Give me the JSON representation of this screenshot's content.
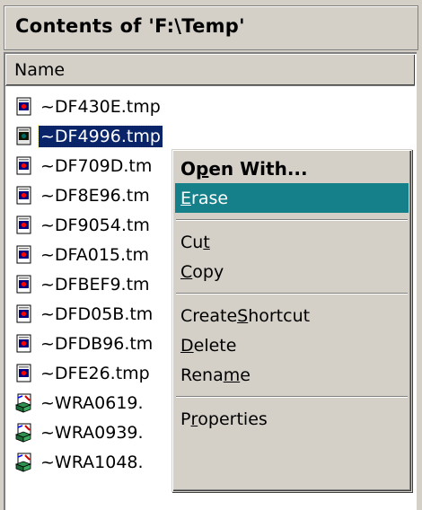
{
  "pane": {
    "title": "Contents of 'F:\\Temp'"
  },
  "list": {
    "column_header": "Name",
    "files": [
      {
        "name": "~DF430E.tmp",
        "icon": "tmp-file-icon"
      },
      {
        "name": "~DF4996.tmp",
        "icon": "tmp-file-icon"
      },
      {
        "name": "~DF709D.tm",
        "icon": "tmp-file-icon"
      },
      {
        "name": "~DF8E96.tm",
        "icon": "tmp-file-icon"
      },
      {
        "name": "~DF9054.tm",
        "icon": "tmp-file-icon"
      },
      {
        "name": "~DFA015.tm",
        "icon": "tmp-file-icon"
      },
      {
        "name": "~DFBEF9.tm",
        "icon": "tmp-file-icon"
      },
      {
        "name": "~DFD05B.tm",
        "icon": "tmp-file-icon"
      },
      {
        "name": "~DFDB96.tm",
        "icon": "tmp-file-icon"
      },
      {
        "name": "~DFE26.tmp",
        "icon": "tmp-file-icon"
      },
      {
        "name": "~WRA0619.",
        "icon": "word-temp-file-icon"
      },
      {
        "name": "~WRA0939.",
        "icon": "word-temp-file-icon"
      },
      {
        "name": "~WRA1048.",
        "icon": "word-temp-file-icon"
      }
    ]
  },
  "context_menu": {
    "open_with": {
      "pre": "O",
      "acc": "p",
      "post": "en With..."
    },
    "erase": {
      "pre": "",
      "acc": "E",
      "post": "rase"
    },
    "cut": {
      "pre": "Cu",
      "acc": "t",
      "post": ""
    },
    "copy": {
      "pre": "",
      "acc": "C",
      "post": "opy"
    },
    "create_shortcut": {
      "pre": "Create ",
      "acc": "S",
      "post": "hortcut"
    },
    "delete": {
      "pre": "",
      "acc": "D",
      "post": "elete"
    },
    "rename": {
      "pre": "Rena",
      "acc": "m",
      "post": "e"
    },
    "properties": {
      "pre": "P",
      "acc": "r",
      "post": "operties"
    }
  },
  "colors": {
    "selection": "#0a246a",
    "menu_highlight": "#16808a",
    "face": "#d4d0c8"
  }
}
